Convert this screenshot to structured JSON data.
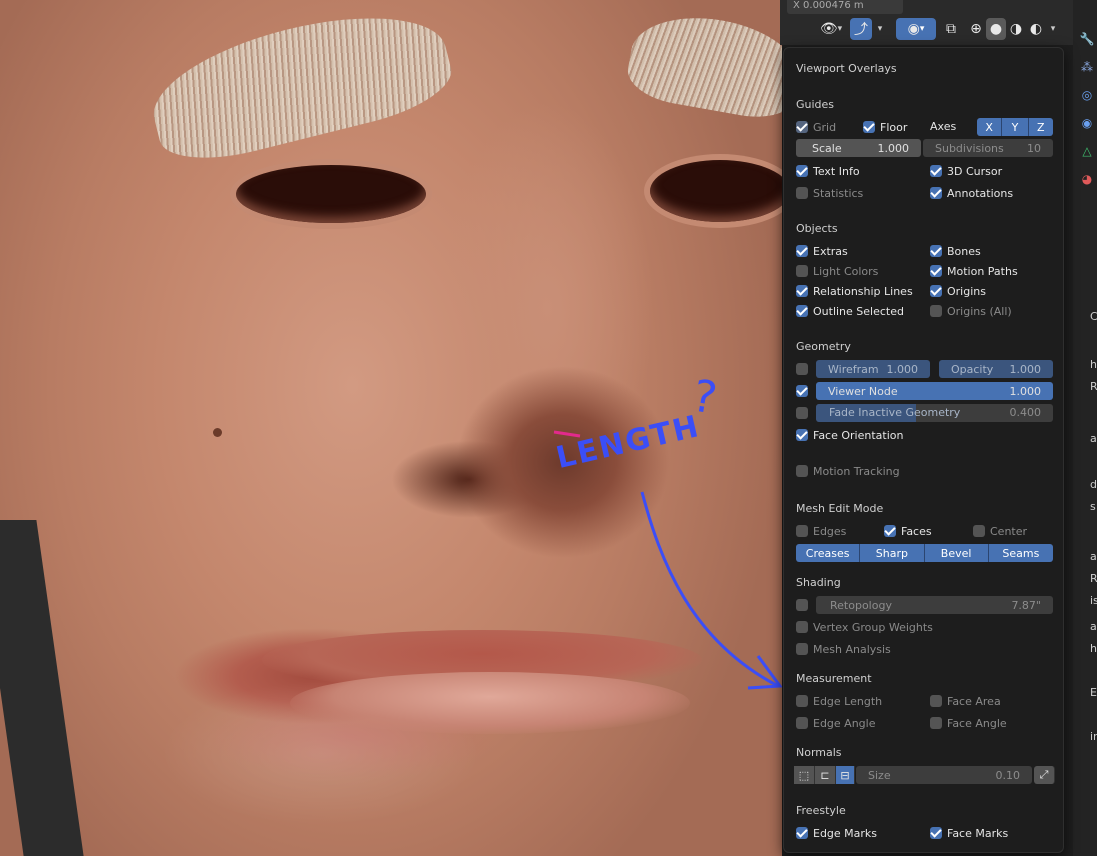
{
  "header": {
    "coord_readout": "X   0.000476 m"
  },
  "popup": {
    "title": "Viewport Overlays",
    "guides": {
      "heading": "Guides",
      "grid": {
        "label": "Grid",
        "checked": true
      },
      "floor": {
        "label": "Floor",
        "checked": true
      },
      "axes_label": "Axes",
      "axes": [
        "X",
        "Y",
        "Z"
      ],
      "scale_label": "Scale",
      "scale_value": "1.000",
      "subdivisions_label": "Subdivisions",
      "subdivisions_value": "10",
      "text_info": {
        "label": "Text Info",
        "checked": true
      },
      "cursor_3d": {
        "label": "3D Cursor",
        "checked": true
      },
      "statistics": {
        "label": "Statistics",
        "checked": false
      },
      "annotations": {
        "label": "Annotations",
        "checked": true
      }
    },
    "objects": {
      "heading": "Objects",
      "extras": {
        "label": "Extras",
        "checked": true
      },
      "bones": {
        "label": "Bones",
        "checked": true
      },
      "light_colors": {
        "label": "Light Colors",
        "checked": false
      },
      "motion_paths": {
        "label": "Motion Paths",
        "checked": true
      },
      "relationship_lines": {
        "label": "Relationship Lines",
        "checked": true
      },
      "origins": {
        "label": "Origins",
        "checked": true
      },
      "outline_selected": {
        "label": "Outline Selected",
        "checked": true
      },
      "origins_all": {
        "label": "Origins (All)",
        "checked": false
      }
    },
    "geometry": {
      "heading": "Geometry",
      "wireframe_label": "Wirefram",
      "wireframe_value": "1.000",
      "opacity_label": "Opacity",
      "opacity_value": "1.000",
      "viewer_node_label": "Viewer Node",
      "viewer_node_value": "1.000",
      "fade_label": "Fade Inactive Geometry",
      "fade_value": "0.400",
      "face_orientation": {
        "label": "Face Orientation",
        "checked": true
      },
      "motion_tracking": {
        "label": "Motion Tracking",
        "checked": false
      }
    },
    "mesh_edit": {
      "heading": "Mesh Edit Mode",
      "edges": {
        "label": "Edges",
        "checked": false
      },
      "faces": {
        "label": "Faces",
        "checked": true
      },
      "center": {
        "label": "Center",
        "checked": false
      },
      "toggles": [
        "Creases",
        "Sharp",
        "Bevel",
        "Seams"
      ]
    },
    "shading": {
      "heading": "Shading",
      "retopology_label": "Retopology",
      "retopology_value": "7.87\"",
      "vertex_group_weights": {
        "label": "Vertex Group Weights",
        "checked": false
      },
      "mesh_analysis": {
        "label": "Mesh Analysis",
        "checked": false
      }
    },
    "measurement": {
      "heading": "Measurement",
      "edge_length": {
        "label": "Edge Length",
        "checked": false
      },
      "face_area": {
        "label": "Face Area",
        "checked": false
      },
      "edge_angle": {
        "label": "Edge Angle",
        "checked": false
      },
      "face_angle": {
        "label": "Face Angle",
        "checked": false
      }
    },
    "normals": {
      "heading": "Normals",
      "size_label": "Size",
      "size_value": "0.10"
    },
    "freestyle": {
      "heading": "Freestyle",
      "edge_marks": {
        "label": "Edge Marks",
        "checked": true
      },
      "face_marks": {
        "label": "Face Marks",
        "checked": true
      }
    }
  },
  "annotation": {
    "text": "LENGTH",
    "question": "?",
    "color": "#3b4ef7"
  },
  "right_strip_chars": [
    "C",
    "h",
    "R",
    "a",
    "d",
    "s",
    "a",
    "R",
    "is",
    "ar",
    "h",
    "E",
    "in"
  ]
}
